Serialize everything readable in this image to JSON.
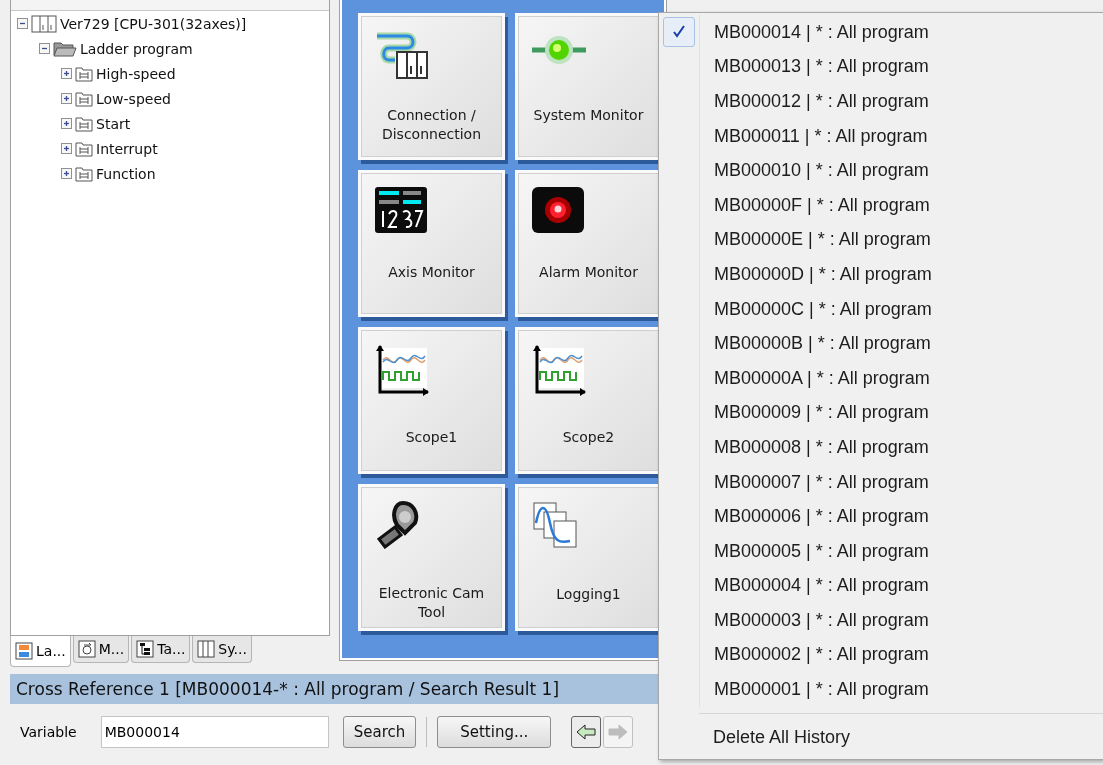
{
  "tree": {
    "root": {
      "label": "Ver729 [CPU-301(32axes)]",
      "kind": "cpu",
      "expanded": true,
      "children": [
        {
          "label": "Ladder program",
          "kind": "folder",
          "expanded": true,
          "children": [
            {
              "label": "High-speed",
              "kind": "program",
              "expanded": false
            },
            {
              "label": "Low-speed",
              "kind": "program",
              "expanded": false
            },
            {
              "label": "Start",
              "kind": "program",
              "expanded": false
            },
            {
              "label": "Interrupt",
              "kind": "program",
              "expanded": false
            },
            {
              "label": "Function",
              "kind": "program",
              "expanded": false
            }
          ]
        }
      ]
    }
  },
  "panel_tabs": [
    {
      "label": "La...",
      "kind": "ladder",
      "selected": true
    },
    {
      "label": "M...",
      "kind": "motion",
      "selected": false
    },
    {
      "label": "Ta...",
      "kind": "table",
      "selected": false
    },
    {
      "label": "Sy...",
      "kind": "system",
      "selected": false
    }
  ],
  "tiles": [
    {
      "label": "Connection / Disconnection",
      "kind": "connection"
    },
    {
      "label": "System Monitor",
      "kind": "system"
    },
    {
      "label": "Axis Monitor",
      "kind": "axis"
    },
    {
      "label": "Alarm Monitor",
      "kind": "alarm"
    },
    {
      "label": "Scope1",
      "kind": "scope"
    },
    {
      "label": "Scope2",
      "kind": "scope"
    },
    {
      "label": "Electronic Cam Tool",
      "kind": "cam"
    },
    {
      "label": "Logging1",
      "kind": "logging"
    }
  ],
  "cross_reference": {
    "title": "Cross Reference 1 [MB000014-* : All program  / Search Result 1]",
    "variable_label": "Variable",
    "variable_value": "MB000014",
    "search_button": "Search",
    "setting_button": "Setting...",
    "back_enabled": true,
    "forward_enabled": false
  },
  "history_menu": {
    "items": [
      {
        "label": "MB000014 | * : All program",
        "checked": true
      },
      {
        "label": "MB000013 | * : All program",
        "checked": false
      },
      {
        "label": "MB000012 | * : All program",
        "checked": false
      },
      {
        "label": "MB000011 | * : All program",
        "checked": false
      },
      {
        "label": "MB000010 | * : All program",
        "checked": false
      },
      {
        "label": "MB00000F | * : All program",
        "checked": false
      },
      {
        "label": "MB00000E | * : All program",
        "checked": false
      },
      {
        "label": "MB00000D | * : All program",
        "checked": false
      },
      {
        "label": "MB00000C | * : All program",
        "checked": false
      },
      {
        "label": "MB00000B | * : All program",
        "checked": false
      },
      {
        "label": "MB00000A | * : All program",
        "checked": false
      },
      {
        "label": "MB000009 | * : All program",
        "checked": false
      },
      {
        "label": "MB000008 | * : All program",
        "checked": false
      },
      {
        "label": "MB000007 | * : All program",
        "checked": false
      },
      {
        "label": "MB000006 | * : All program",
        "checked": false
      },
      {
        "label": "MB000005 | * : All program",
        "checked": false
      },
      {
        "label": "MB000004 | * : All program",
        "checked": false
      },
      {
        "label": "MB000003 | * : All program",
        "checked": false
      },
      {
        "label": "MB000002 | * : All program",
        "checked": false
      },
      {
        "label": "MB000001 | * : All program",
        "checked": false
      }
    ],
    "footer": "Delete All History"
  }
}
